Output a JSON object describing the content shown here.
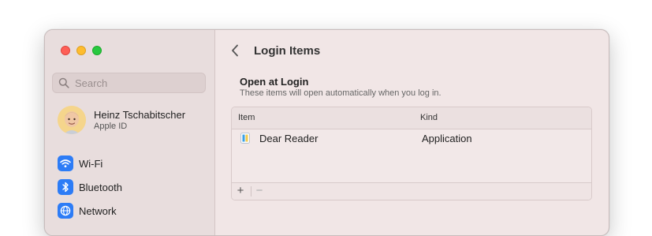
{
  "sidebar": {
    "search_placeholder": "Search",
    "user": {
      "name": "Heinz Tschabitscher",
      "subtitle": "Apple ID"
    },
    "items": [
      {
        "label": "Wi-Fi",
        "icon": "wifi-icon"
      },
      {
        "label": "Bluetooth",
        "icon": "bluetooth-icon"
      },
      {
        "label": "Network",
        "icon": "globe-icon"
      }
    ]
  },
  "main": {
    "title": "Login Items",
    "section": {
      "title": "Open at Login",
      "subtitle": "These items will open automatically when you log in."
    },
    "table": {
      "columns": [
        "Item",
        "Kind"
      ],
      "rows": [
        {
          "item": "Dear Reader",
          "kind": "Application"
        }
      ],
      "add_label": "+",
      "remove_label": "−"
    }
  },
  "colors": {
    "accent": "#2d7cf6",
    "close": "#fe5f57",
    "minimize": "#febc2e",
    "zoom": "#28c840"
  }
}
